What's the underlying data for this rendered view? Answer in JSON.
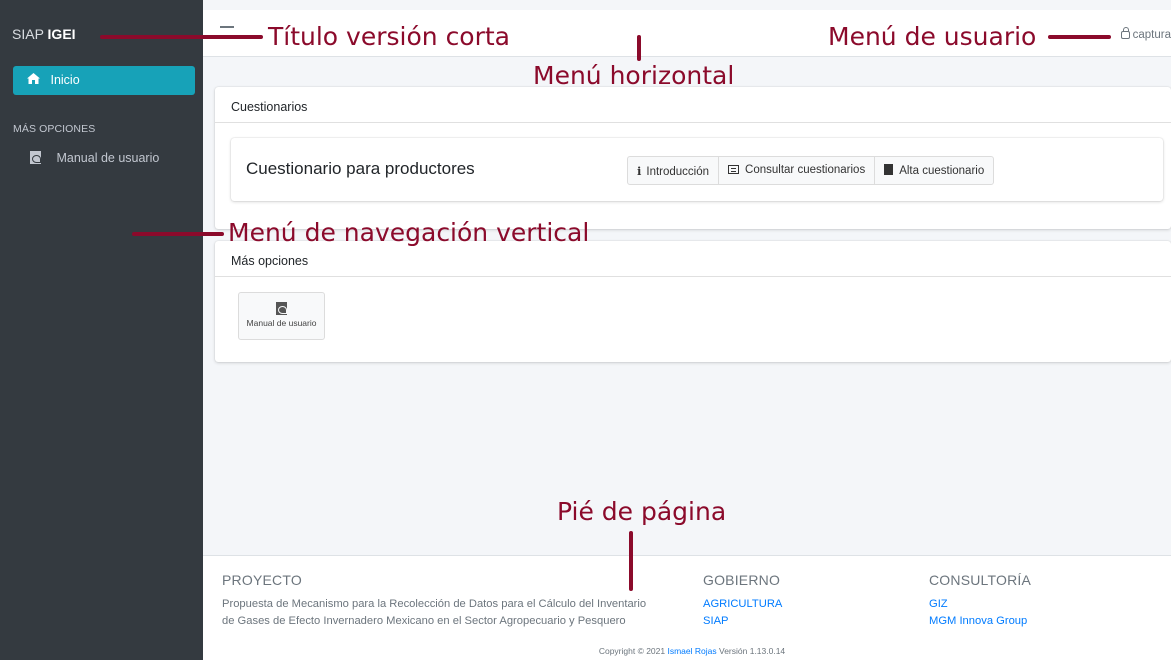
{
  "brand": {
    "prefix": "SIAP",
    "bold": "IGEI"
  },
  "sidebar": {
    "active_item": {
      "label": "Inicio",
      "icon": "home-icon"
    },
    "section_label": "MÁS OPCIONES",
    "items": [
      {
        "label": "Manual de usuario",
        "icon": "pdf-file-icon"
      }
    ]
  },
  "topbar": {
    "user_label": "captura",
    "user_icon": "lock-icon"
  },
  "card_cuestionarios": {
    "header": "Cuestionarios",
    "inner_title": "Cuestionario para productores",
    "buttons": [
      {
        "label": "Introducción",
        "icon": "info-icon"
      },
      {
        "label": "Consultar cuestionarios",
        "icon": "list-icon"
      },
      {
        "label": "Alta cuestionario",
        "icon": "file-icon"
      }
    ]
  },
  "card_mas_opciones": {
    "header": "Más opciones",
    "tile_label": "Manual de usuario"
  },
  "footer": {
    "proyecto": {
      "heading": "PROYECTO",
      "line1": "Propuesta de Mecanismo para la Recolección de Datos para el Cálculo del Inventario",
      "line2": "de Gases de Efecto Invernadero Mexicano en el Sector Agropecuario y Pesquero"
    },
    "gobierno": {
      "heading": "GOBIERNO",
      "links": [
        "AGRICULTURA",
        "SIAP"
      ]
    },
    "consultoria": {
      "heading": "CONSULTORÍA",
      "links": [
        "GIZ",
        "MGM Innova Group"
      ]
    },
    "copyright_prefix": "Copyright © 2021",
    "copyright_author": "Ismael Rojas",
    "copyright_version": "Versión 1.13.0.14"
  },
  "annotations": {
    "titulo": "Título versión corta",
    "menu_horizontal": "Menú horizontal",
    "menu_usuario": "Menú de usuario",
    "menu_vertical": "Menú de navegación vertical",
    "pie": "Pié de página"
  },
  "colors": {
    "sidebar_bg": "#343a40",
    "active_item": "#17a2b8",
    "link": "#007bff",
    "annotation": "#8b0a2b"
  }
}
